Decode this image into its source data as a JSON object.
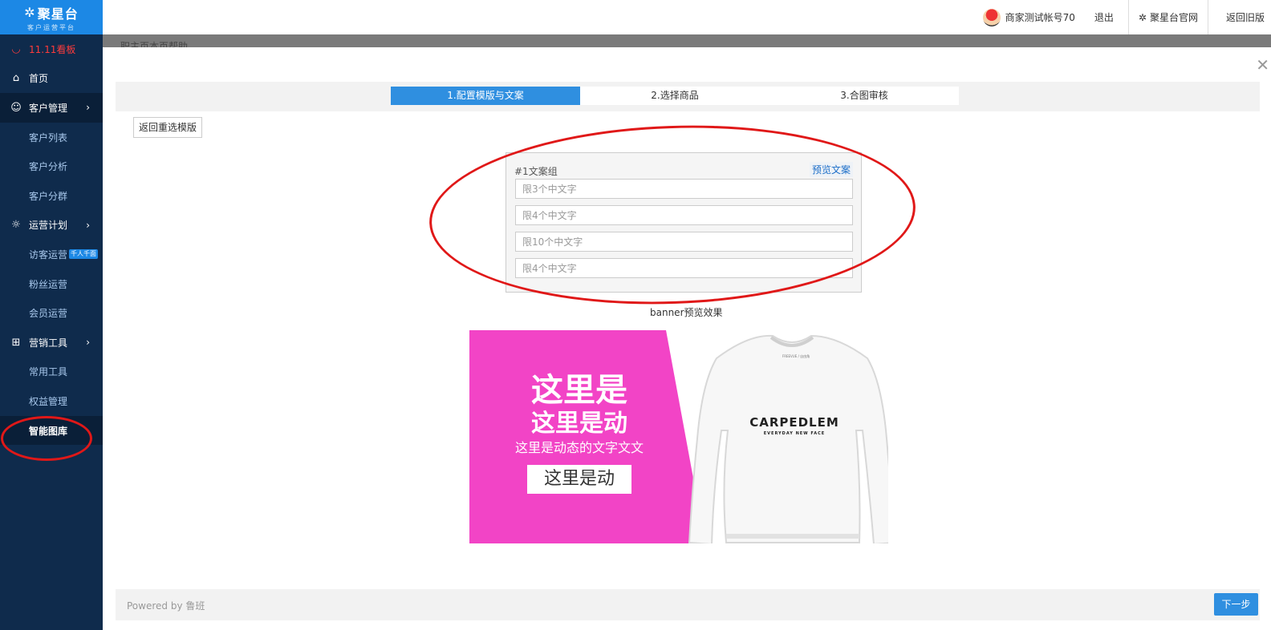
{
  "app": {
    "logo_title": "聚星台",
    "logo_subtitle": "客户运营平台"
  },
  "sidebar": {
    "items": [
      {
        "label": "11.11看板",
        "icon": "dashboard-icon"
      },
      {
        "label": "首页",
        "icon": "home-icon"
      },
      {
        "label": "客户管理",
        "icon": "customers-icon"
      },
      {
        "label": "客户列表"
      },
      {
        "label": "客户分析"
      },
      {
        "label": "客户分群"
      },
      {
        "label": "运营计划",
        "icon": "lightbulb-icon"
      },
      {
        "label": "访客运营",
        "badge": "千人千面"
      },
      {
        "label": "粉丝运营"
      },
      {
        "label": "会员运营"
      },
      {
        "label": "营销工具",
        "icon": "gift-icon"
      },
      {
        "label": "常用工具"
      },
      {
        "label": "权益管理"
      },
      {
        "label": "智能图库"
      }
    ]
  },
  "header": {
    "account": "商家测试帐号70",
    "logout": "退出",
    "official_site": "聚星台官网",
    "old_version": "返回旧版"
  },
  "overlay": {
    "background_text": "职主页本页帮助"
  },
  "wizard": {
    "steps": [
      "1.配置模版与文案",
      "2.选择商品",
      "3.合图审核"
    ],
    "active_step": 0,
    "back_button": "返回重选模版",
    "group_label": "#1文案组",
    "preview_copy": "预览文案",
    "inputs": [
      {
        "placeholder": "限3个中文字",
        "value": ""
      },
      {
        "placeholder": "限4个中文字",
        "value": ""
      },
      {
        "placeholder": "限10个中文字",
        "value": ""
      },
      {
        "placeholder": "限4个中文字",
        "value": ""
      }
    ],
    "preview_caption": "banner预览效果"
  },
  "banner": {
    "line1": "这里是",
    "line2": "这里是动",
    "line3": "这里是动态的文字文文",
    "button": "这里是动",
    "brand": "CARPEDLEM",
    "brand_sub": "EVERYDAY NEW FACE",
    "tag": "FREEVUE / 自由角",
    "pink_color": "#f244c6"
  },
  "footer": {
    "powered_by": "Powered by 鲁班",
    "next_button": "下一步"
  },
  "colors": {
    "accent": "#2f8fe0",
    "sidebar_bg": "#0f2b4c",
    "annotation": "#e01818"
  }
}
